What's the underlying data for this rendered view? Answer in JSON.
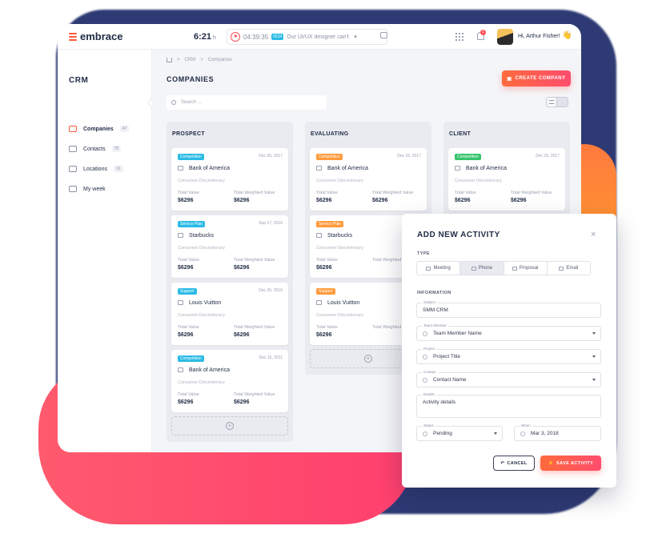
{
  "app": {
    "logo_text": "embrace",
    "clock_time": "6:21",
    "clock_unit": "h",
    "timer": {
      "time": "04:39:35",
      "badge": "#214",
      "task": "Our UI/UX designer can't access ...",
      "caret": "▾"
    },
    "notifications_count": "1",
    "greeting": "Hi, Arthur Fisher!",
    "wave": "👋"
  },
  "sidebar": {
    "title": "CRM",
    "items": [
      {
        "label": "Companies",
        "count": "47"
      },
      {
        "label": "Contacts",
        "count": "75"
      },
      {
        "label": "Locations",
        "count": "31"
      },
      {
        "label": "My week",
        "count": ""
      }
    ]
  },
  "main": {
    "breadcrumb": [
      "CRM",
      "Companies"
    ],
    "breadcrumb_sep": ">",
    "title": "COMPANIES",
    "create_button": "CREATE COMPANY",
    "search_placeholder": "Search ...",
    "add_symbol": "+"
  },
  "columns": [
    {
      "title": "PROSPECT",
      "cards": [
        {
          "tag": "Competition",
          "tag_color": "#2bbbe6",
          "date": "Dec 05, 2017",
          "company": "Bank of America",
          "category": "Consumer Discretionary",
          "total_label": "Total Value",
          "total": "$6296",
          "weighted_label": "Total Weighted Value",
          "weighted": "$6296"
        },
        {
          "tag": "Service Plan",
          "tag_color": "#2bbbe6",
          "date": "Sep 17, 2016",
          "company": "Starbucks",
          "category": "Consumer Discretionary",
          "total_label": "Total Value",
          "total": "$6296",
          "weighted_label": "Total Weighted Value",
          "weighted": "$6296"
        },
        {
          "tag": "Support",
          "tag_color": "#2bbbe6",
          "date": "Dec 26, 2016",
          "company": "Louis Vuitton",
          "category": "Consumer Discretionary",
          "total_label": "Total Value",
          "total": "$6296",
          "weighted_label": "Total Weighted Value",
          "weighted": "$6296"
        },
        {
          "tag": "Competition",
          "tag_color": "#2bbbe6",
          "date": "Dec 15, 2011",
          "company": "Bank of America",
          "category": "Consumer Discretionary",
          "total_label": "Total Value",
          "total": "$6296",
          "weighted_label": "Total Weighted Value",
          "weighted": "$6296"
        }
      ]
    },
    {
      "title": "EVALUATING",
      "cards": [
        {
          "tag": "Competition",
          "tag_color": "#ff9a3c",
          "date": "Dec 15, 2017",
          "company": "Bank of America",
          "category": "Consumer Discretionary",
          "total_label": "Total Value",
          "total": "$6296",
          "weighted_label": "Total Weighted Value",
          "weighted": "$6296"
        },
        {
          "tag": "Service Plan",
          "tag_color": "#ff9a3c",
          "date": "",
          "company": "Starbucks",
          "category": "Consumer Discretionary",
          "total_label": "Total Value",
          "total": "$6296",
          "weighted_label": "Total Weighted Value",
          "weighted": ""
        },
        {
          "tag": "Support",
          "tag_color": "#ff9a3c",
          "date": "",
          "company": "Louis Vuitton",
          "category": "Consumer Discretionary",
          "total_label": "Total Value",
          "total": "$6296",
          "weighted_label": "Total Weighted Value",
          "weighted": ""
        }
      ]
    },
    {
      "title": "CLIENT",
      "cards": [
        {
          "tag": "Competition",
          "tag_color": "#37c36b",
          "date": "Dec 15, 2017",
          "company": "Bank of America",
          "category": "Consumer Discretionary",
          "total_label": "Total Value",
          "total": "$6296",
          "weighted_label": "Total Weighted Value",
          "weighted": "$6296"
        }
      ]
    }
  ],
  "modal": {
    "title": "ADD NEW ACTIVITY",
    "close": "×",
    "type_label": "TYPE",
    "types": [
      "Meeting",
      "Phone",
      "Proposal",
      "Email"
    ],
    "info_label": "INFORMATION",
    "fields": {
      "subject_label": "Subject",
      "subject": "SMM CRM",
      "member_label": "Team Member",
      "member": "Team Member Name",
      "project_label": "Project",
      "project": "Project Title",
      "contact_label": "Contact",
      "contact": "Contact Name",
      "details_label": "Details",
      "details": "Activity details",
      "status_label": "Status",
      "status": "Pending",
      "when_label": "When",
      "when": "Mar 3, 2018"
    },
    "cancel": "CANCEL",
    "save": "SAVE ACTIVITY"
  }
}
